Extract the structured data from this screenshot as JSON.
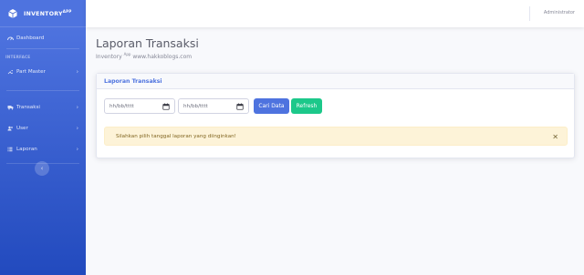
{
  "brand": {
    "name": "INVENTORY",
    "sup": "APP",
    "icon": "box-icon"
  },
  "sidebar": {
    "dashboard": {
      "label": "Dashboard",
      "icon": "dashboard-icon"
    },
    "heading_interface": "INTERFACE",
    "items": [
      {
        "label": "Part Master",
        "icon": "wrench-icon"
      },
      {
        "label": "Transaksi",
        "icon": "truck-icon"
      },
      {
        "label": "User",
        "icon": "users-icon"
      },
      {
        "label": "Laporan",
        "icon": "list-icon"
      }
    ],
    "toggle_icon": "chevron-left-icon"
  },
  "topbar": {
    "user": "Administrator"
  },
  "page": {
    "title": "Laporan Transaksi",
    "subtitle_prefix": "Inventory",
    "subtitle_sup": "App",
    "subtitle_suffix": "www.hakkoblogs.com"
  },
  "card": {
    "header": "Laporan Transaksi",
    "date_from_placeholder": "hh/bb/tttt",
    "date_to_placeholder": "hh/bb/tttt",
    "search_label": "Cari Data",
    "refresh_label": "Refresh",
    "alert_text": "Silahkan pilih tanggal laporan yang diinginkan!",
    "alert_close": "×"
  },
  "colors": {
    "primary": "#4e73df",
    "success": "#1cc88a",
    "warning_bg": "#fdf3d8"
  }
}
